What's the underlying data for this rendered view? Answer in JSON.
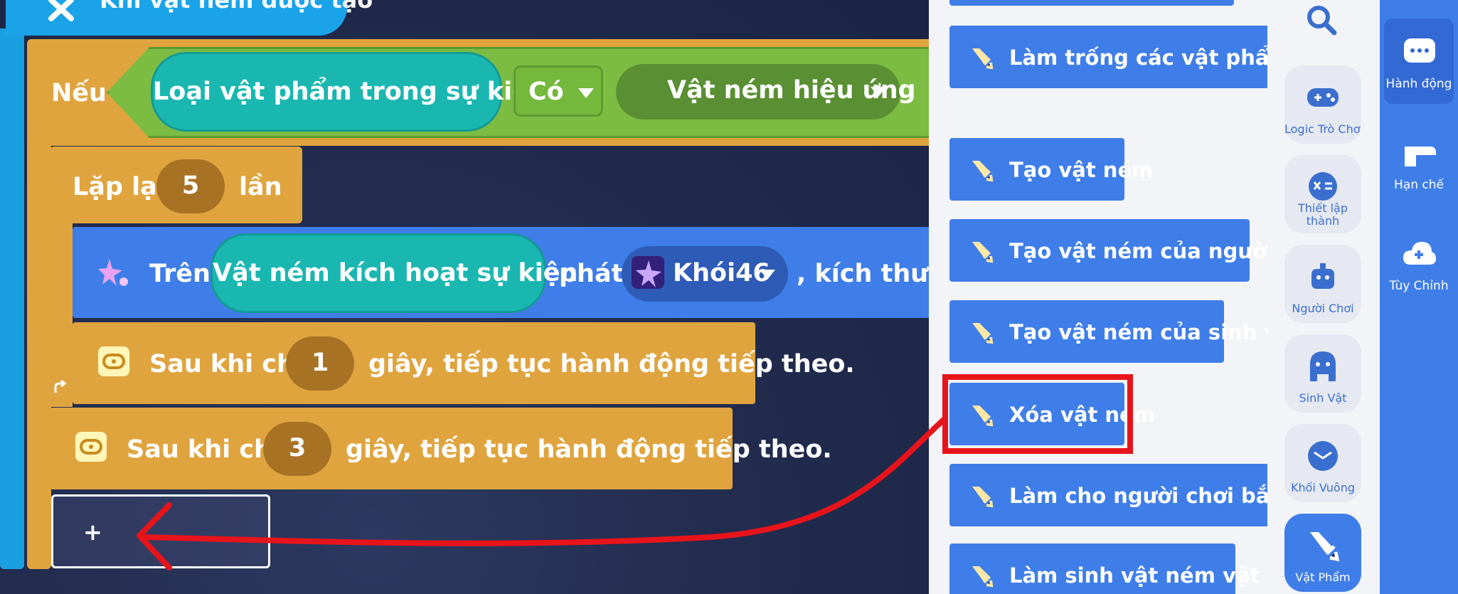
{
  "event_hat": {
    "label": "Khi vật ném được tạo"
  },
  "if_block": {
    "label": "Nếu",
    "condition_left": "Loại vật phẩm trong sự kiện",
    "operator": "Có",
    "condition_right": "Vật ném hiệu ứng"
  },
  "repeat_block": {
    "prefix": "Lặp lại",
    "count": "5",
    "suffix": "lần"
  },
  "emit_block": {
    "prefix": "Trên",
    "target": "Vật ném kích hoạt sự kiện",
    "verb": "phát",
    "effect": "Khói46",
    "trailing": ", kích thước"
  },
  "wait_block_1": {
    "prefix": "Sau khi chờ",
    "seconds": "1",
    "suffix": "giây, tiếp tục hành động tiếp theo."
  },
  "wait_block_2": {
    "prefix": "Sau khi chờ",
    "seconds": "3",
    "suffix": "giây, tiếp tục hành động tiếp theo."
  },
  "add_button": {
    "label": "+"
  },
  "palette": {
    "items": [
      {
        "label": "Làm trống các vật phẩm trong rương"
      },
      {
        "label": "Tạo vật ném"
      },
      {
        "label": "Tạo vật ném của người chơi"
      },
      {
        "label": "Tạo vật ném của sinh vật"
      },
      {
        "label": "Xóa vật ném"
      },
      {
        "label": "Làm cho người chơi bắn vật ném"
      },
      {
        "label": "Làm sinh vật ném vật ném"
      }
    ]
  },
  "categories": {
    "items": [
      {
        "label": "Logic Trò Chơi",
        "icon": "gamepad-icon"
      },
      {
        "label": "Thiết lập thành",
        "icon": "math-icon"
      },
      {
        "label": "Người Chơi",
        "icon": "player-icon"
      },
      {
        "label": "Sinh Vật",
        "icon": "creature-icon"
      },
      {
        "label": "Khối Vuông",
        "icon": "cube-icon"
      },
      {
        "label": "Vật Phẩm",
        "icon": "sword-icon"
      }
    ]
  },
  "tabs": {
    "items": [
      {
        "label": "Hành động",
        "icon": "chat-icon"
      },
      {
        "label": "Hạn chế",
        "icon": "restrict-icon"
      },
      {
        "label": "Tùy Chỉnh",
        "icon": "cloud-add-icon"
      }
    ]
  },
  "colors": {
    "event_blue": "#1aa3e8",
    "control_orange": "#e0a43f",
    "condition_green": "#7cbc43",
    "action_blue": "#3f7ee8",
    "highlight_red": "#e8141b"
  }
}
